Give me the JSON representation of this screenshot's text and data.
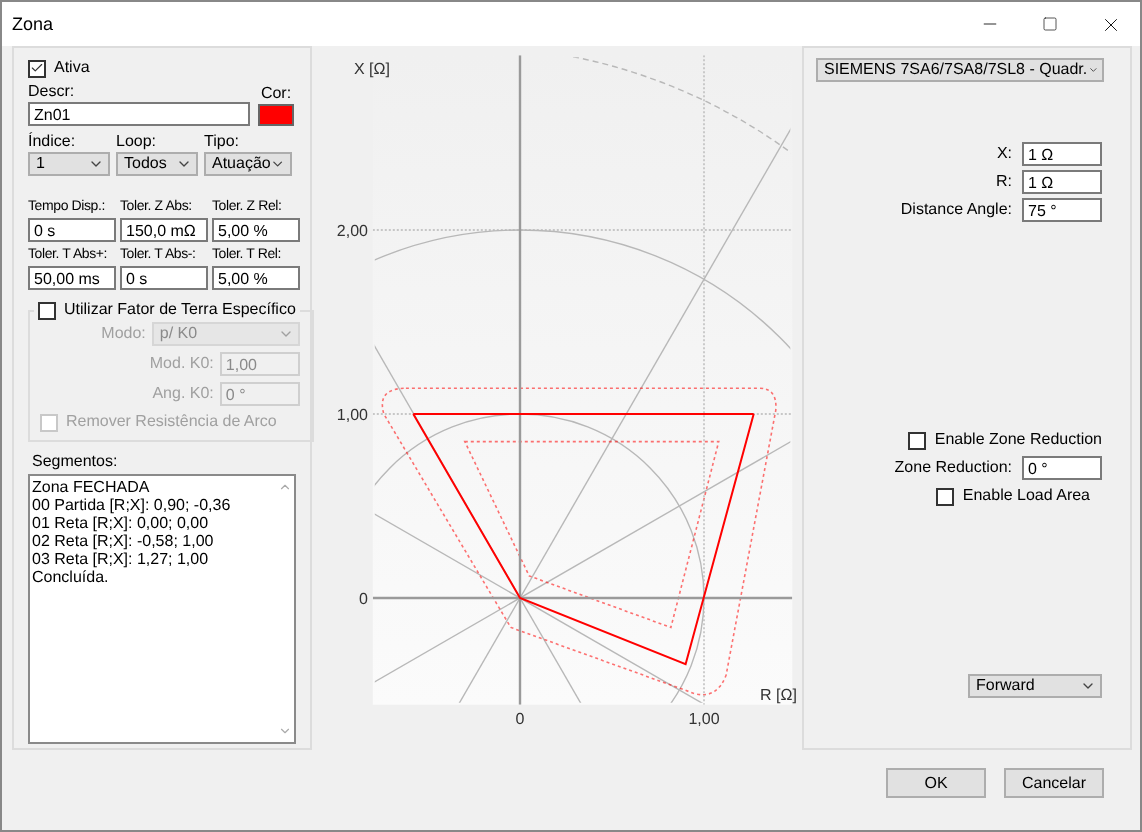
{
  "window": {
    "title": "Zona"
  },
  "zone": {
    "active": {
      "label": "Ativa",
      "checked": true
    },
    "description": {
      "label": "Descr:",
      "value": "Zn01"
    },
    "color_label": "Cor:",
    "color": "#ff0000",
    "selects": [
      {
        "label": "Índice:",
        "value": "1"
      },
      {
        "label": "Loop:",
        "value": "Todos"
      },
      {
        "label": "Tipo:",
        "value": "Atuação"
      }
    ],
    "fields": [
      {
        "label": "Tempo Disp.:",
        "value": "0 s"
      },
      {
        "label": "Toler. Z Abs:",
        "value": "150,0 mΩ"
      },
      {
        "label": "Toler. Z Rel:",
        "value": "5,00 %"
      },
      {
        "label": "Toler. T Abs+:",
        "value": "50,00 ms"
      },
      {
        "label": "Toler. T Abs-:",
        "value": "0 s"
      },
      {
        "label": "Toler. T Rel:",
        "value": "5,00 %"
      }
    ],
    "ground_factor": {
      "label": "Utilizar Fator de Terra Específico",
      "checked": false,
      "mode": {
        "label": "Modo:",
        "value": "p/ K0",
        "disabled": true
      },
      "fields": [
        {
          "label": "Mod. K0:",
          "value": "1,00",
          "disabled": true
        },
        {
          "label": "Ang. K0:",
          "value": "0 °",
          "disabled": true
        }
      ],
      "remove_arc": {
        "label": "Remover Resistência de Arco",
        "checked": false,
        "disabled": true
      }
    },
    "segments": {
      "label": "Segmentos:",
      "lines": [
        "Zona FECHADA",
        "00 Partida [R;X]: 0,90; -0,36",
        "01 Reta [R;X]: 0,00; 0,00",
        "02 Reta [R;X]: -0,58; 1,00",
        "03 Reta [R;X]: 1,27; 1,00",
        "Concluída."
      ]
    }
  },
  "chart": {
    "chart_data": {
      "type": "line",
      "xlabel": "R [Ω]",
      "ylabel": "X [Ω]",
      "x": [
        -0.58,
        0,
        0.9,
        1.27
      ],
      "series": [
        {
          "color": "#ff0000",
          "values": [
            1,
            0,
            -0.36,
            1
          ]
        },
        {
          "color": "#ff0000",
          "values": [
            1,
            1,
            1,
            1
          ]
        }
      ],
      "grid": true,
      "xlim": [
        -0.8,
        1.48
      ],
      "ylim": [
        -0.58,
        2.95
      ],
      "xticks": [
        {
          "value": 0,
          "label": "0"
        },
        {
          "value": 1,
          "label": "1,00"
        }
      ],
      "yticks": [
        {
          "value": 0,
          "label": "0"
        },
        {
          "value": 1,
          "label": "1,00"
        },
        {
          "value": 2,
          "label": "2,00"
        }
      ]
    }
  },
  "settings": {
    "device": "SIEMENS 7SA6/7SA8/7SL8 - Quadr.",
    "fields": [
      {
        "label": "X:",
        "value": "1 Ω"
      },
      {
        "label": "R:",
        "value": "1 Ω"
      },
      {
        "label": "Distance Angle:",
        "value": "75 °"
      }
    ],
    "zone_reduction_enabled": {
      "label": "Enable Zone Reduction",
      "checked": false
    },
    "zone_reduction": {
      "label": "Zone Reduction:",
      "value": "0 °"
    },
    "load_area": {
      "label": "Enable Load Area",
      "checked": false
    },
    "direction": "Forward"
  },
  "buttons": [
    {
      "label": "OK"
    },
    {
      "label": "Cancelar"
    }
  ]
}
